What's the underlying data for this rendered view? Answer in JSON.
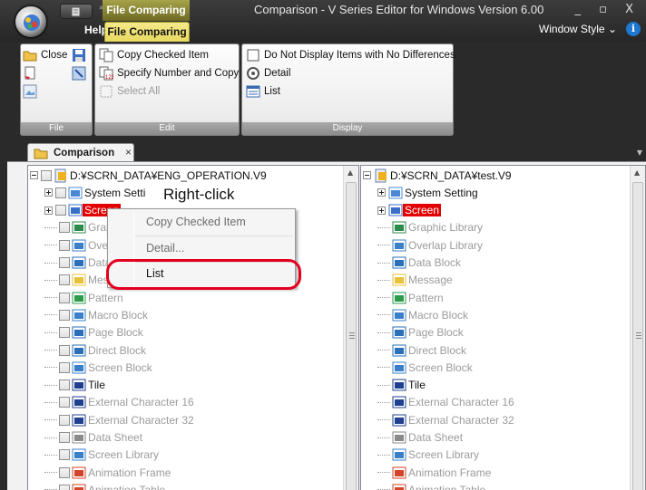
{
  "window": {
    "title": "Comparison - V Series Editor for Windows Version 6.00",
    "context_tab_title": "File Comparing",
    "window_style_label": "Window Style",
    "window_buttons": "_ ▫ X"
  },
  "ribbon_tabs": {
    "help": "Help",
    "file_comparing": "File Comparing"
  },
  "ribbon": {
    "file_group": {
      "label": "File",
      "close": "Close"
    },
    "edit_group": {
      "label": "Edit",
      "copy_checked_item": "Copy Checked Item",
      "specify_number_and_copy": "Specify Number and Copy",
      "select_all": "Select All"
    },
    "display_group": {
      "label": "Display",
      "do_not_display": "Do Not Display Items with No Differences",
      "detail": "Detail",
      "list": "List"
    }
  },
  "doc_tab": {
    "label": "Comparison",
    "close": "×"
  },
  "left_tree": {
    "root": "D:¥SCRN_DATA¥ENG_OPERATION.V9",
    "items": [
      {
        "label": "System Setti",
        "style": "black"
      },
      {
        "label": "Screen",
        "style": "sel"
      },
      {
        "label": "Graphic",
        "style": "gray"
      },
      {
        "label": "Overlap",
        "style": "gray"
      },
      {
        "label": "Data",
        "style": "gray"
      },
      {
        "label": "Messa",
        "style": "gray"
      },
      {
        "label": "Pattern",
        "style": "gray"
      },
      {
        "label": "Macro Block",
        "style": "gray"
      },
      {
        "label": "Page Block",
        "style": "gray"
      },
      {
        "label": "Direct Block",
        "style": "gray"
      },
      {
        "label": "Screen Block",
        "style": "gray"
      },
      {
        "label": "Tile",
        "style": "black"
      },
      {
        "label": "External Character 16",
        "style": "gray"
      },
      {
        "label": "External Character 32",
        "style": "gray"
      },
      {
        "label": "Data Sheet",
        "style": "gray"
      },
      {
        "label": "Screen Library",
        "style": "gray"
      },
      {
        "label": "Animation Frame",
        "style": "gray"
      },
      {
        "label": "Animation Table",
        "style": "gray"
      }
    ]
  },
  "right_tree": {
    "root": "D:¥SCRN_DATA¥test.V9",
    "items": [
      {
        "label": "System Setting",
        "style": "black"
      },
      {
        "label": "Screen",
        "style": "sel"
      },
      {
        "label": "Graphic Library",
        "style": "gray"
      },
      {
        "label": "Overlap Library",
        "style": "gray"
      },
      {
        "label": "Data Block",
        "style": "gray"
      },
      {
        "label": "Message",
        "style": "gray"
      },
      {
        "label": "Pattern",
        "style": "gray"
      },
      {
        "label": "Macro Block",
        "style": "gray"
      },
      {
        "label": "Page Block",
        "style": "gray"
      },
      {
        "label": "Direct Block",
        "style": "gray"
      },
      {
        "label": "Screen Block",
        "style": "gray"
      },
      {
        "label": "Tile",
        "style": "black"
      },
      {
        "label": "External Character 16",
        "style": "gray"
      },
      {
        "label": "External Character 32",
        "style": "gray"
      },
      {
        "label": "Data Sheet",
        "style": "gray"
      },
      {
        "label": "Screen Library",
        "style": "gray"
      },
      {
        "label": "Animation Frame",
        "style": "gray"
      },
      {
        "label": "Animation Table",
        "style": "gray"
      }
    ]
  },
  "context_menu": {
    "items": [
      "Copy Checked Item",
      "Detail...",
      "List"
    ],
    "annotation": "Right-click"
  },
  "colors": {
    "selection": "#e30000",
    "highlight_oval": "#e3001e",
    "context_tab": "#a6a34a"
  }
}
